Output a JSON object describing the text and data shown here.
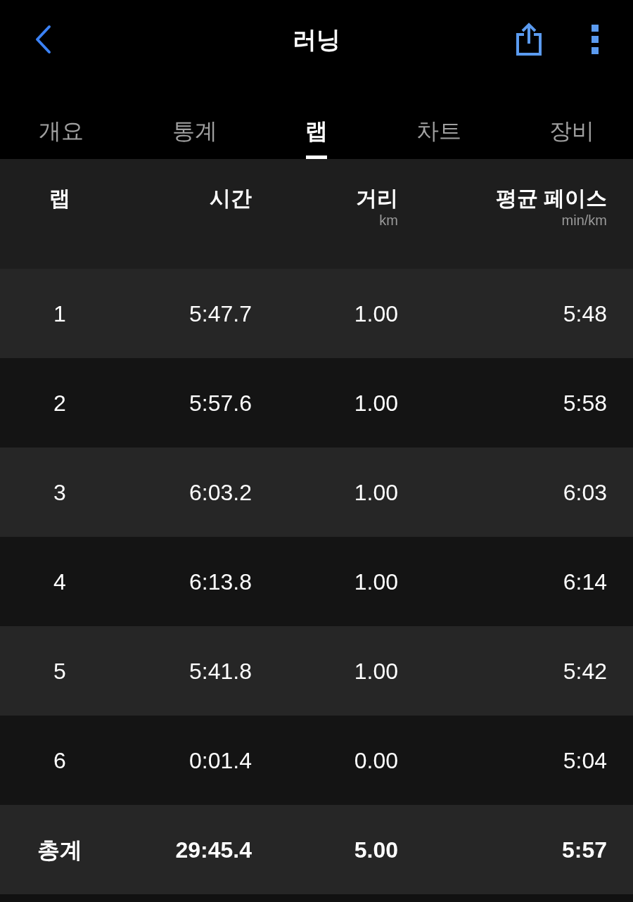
{
  "header": {
    "title": "러닝"
  },
  "tabs": [
    {
      "label": "개요",
      "selected": false
    },
    {
      "label": "통계",
      "selected": false
    },
    {
      "label": "랩",
      "selected": true
    },
    {
      "label": "차트",
      "selected": false
    },
    {
      "label": "장비",
      "selected": false
    }
  ],
  "table": {
    "columns": [
      {
        "label": "랩"
      },
      {
        "label": "시간"
      },
      {
        "label": "거리",
        "unit": "km"
      },
      {
        "label": "평균 페이스",
        "unit": "min/km"
      }
    ],
    "rows": [
      [
        "1",
        "5:47.7",
        "1.00",
        "5:48"
      ],
      [
        "2",
        "5:57.6",
        "1.00",
        "5:58"
      ],
      [
        "3",
        "6:03.2",
        "1.00",
        "6:03"
      ],
      [
        "4",
        "6:13.8",
        "1.00",
        "6:14"
      ],
      [
        "5",
        "5:41.8",
        "1.00",
        "5:42"
      ],
      [
        "6",
        "0:01.4",
        "0.00",
        "5:04"
      ]
    ],
    "total": [
      "총계",
      "29:45.4",
      "5.00",
      "5:57"
    ]
  }
}
